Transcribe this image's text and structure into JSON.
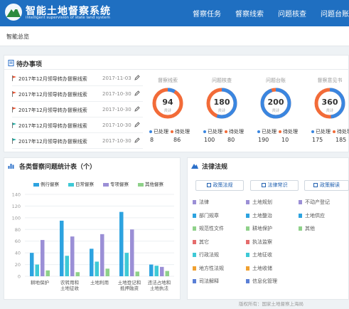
{
  "header": {
    "title": "智能土地督察系统",
    "subtitle": "intelligent supervision of state land system",
    "nav": [
      "督察任务",
      "督察线索",
      "问题核查",
      "问题台账"
    ]
  },
  "breadcrumb": "智能总览",
  "todo": {
    "title": "待办事项",
    "items": [
      {
        "text": "2017年12月领导转办督察线索",
        "date": "2017-11-03",
        "flag_color": "#e8502f"
      },
      {
        "text": "2017年12月领导转办督察线索",
        "date": "2017-10-30",
        "flag_color": "#e8502f"
      },
      {
        "text": "2017年12月领导转办督察线索",
        "date": "2017-10-30",
        "flag_color": "#e8502f"
      },
      {
        "text": "2017年12月领导转办督察线索",
        "date": "2017-10-30",
        "flag_color": "#1aa9a0"
      },
      {
        "text": "2017年12月领导转办督察线索",
        "date": "2017-10-30",
        "flag_color": "#1aa9a0"
      }
    ]
  },
  "stats": [
    {
      "title": "督察线索",
      "total": "94",
      "total_label": "共计",
      "done_label": "已处理",
      "todo_label": "待处理",
      "done": "8",
      "pending": "86",
      "done_fraction": 0.085
    },
    {
      "title": "问题核查",
      "total": "180",
      "total_label": "共计",
      "done_label": "已处理",
      "todo_label": "待处理",
      "done": "100",
      "pending": "80",
      "done_fraction": 0.556
    },
    {
      "title": "问题台账",
      "total": "200",
      "total_label": "共计",
      "done_label": "已处理",
      "todo_label": "待处理",
      "done": "190",
      "pending": "10",
      "done_fraction": 0.95
    },
    {
      "title": "督察意见书",
      "total": "360",
      "total_label": "共计",
      "done_label": "已处理",
      "todo_label": "待处理",
      "done": "175",
      "pending": "185",
      "done_fraction": 0.486
    }
  ],
  "colors": {
    "header": "#1f6fc1",
    "done": "#3a86e0",
    "pending": "#f26b38"
  },
  "chart_panel": {
    "title": "各类督察问题统计表（个）"
  },
  "chart_data": {
    "type": "bar",
    "categories": [
      "耕地保护",
      "农转用和土地征收",
      "土地利用",
      "土地登记和抵押融资",
      "违法占地和土地执法"
    ],
    "series": [
      {
        "name": "例行督察",
        "color": "#2da3e0",
        "values": [
          40,
          95,
          47,
          110,
          20
        ]
      },
      {
        "name": "日常督察",
        "color": "#3ec9d6",
        "values": [
          20,
          35,
          25,
          40,
          18
        ]
      },
      {
        "name": "专项督察",
        "color": "#9b8fd6",
        "values": [
          62,
          68,
          72,
          80,
          16
        ]
      },
      {
        "name": "其他督察",
        "color": "#8fd18a",
        "values": [
          10,
          7,
          13,
          8,
          9
        ]
      }
    ],
    "ylim": [
      0,
      140
    ],
    "yticks": [
      "0",
      "20",
      "40",
      "60",
      "80",
      "100",
      "120",
      "140"
    ],
    "grid": true,
    "legend": "top"
  },
  "law": {
    "title": "法律法规",
    "buttons": [
      "政策法规",
      "法律常识",
      "政策解读"
    ],
    "columns": [
      [
        "法律",
        "部门规章",
        "规范性文件",
        "其它",
        "行政法规",
        "地方性法规",
        "司法解释"
      ],
      [
        "土地规划",
        "土地整治",
        "耕地保护",
        "执法监察",
        "土地征收",
        "土地收储",
        "信息化管理"
      ],
      [
        "不动产登记",
        "土地供应",
        "其他"
      ]
    ],
    "icon_colors": [
      "#9b8fd6",
      "#2da3e0",
      "#8fd18a",
      "#e56c6c",
      "#3ec9d6",
      "#f0a030",
      "#5a7fd6"
    ]
  },
  "footer": "版权所有：国家土地督察上海局"
}
